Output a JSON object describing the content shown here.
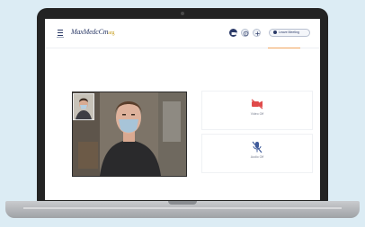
{
  "app": {
    "brand_main": "MaxMedcCm",
    "brand_tld": "arg"
  },
  "header": {
    "leave_label": "Leave Meeting"
  },
  "video": {
    "participant_tile_label": "Video Off",
    "participant_tile_2_label": "Audio Off"
  },
  "icons": {
    "menu": "menu-icon",
    "camera": "video-camera-icon",
    "info": "info-icon",
    "add": "plus-icon",
    "video_off": "video-off-icon",
    "mic_off": "mic-off-icon"
  },
  "colors": {
    "background": "#dcecf4",
    "brand_navy": "#2b3a67",
    "brand_gold": "#c9a227",
    "alert_red": "#e04a4a",
    "mic_blue": "#3e5a9a",
    "accent_orange": "#f0a45d"
  }
}
